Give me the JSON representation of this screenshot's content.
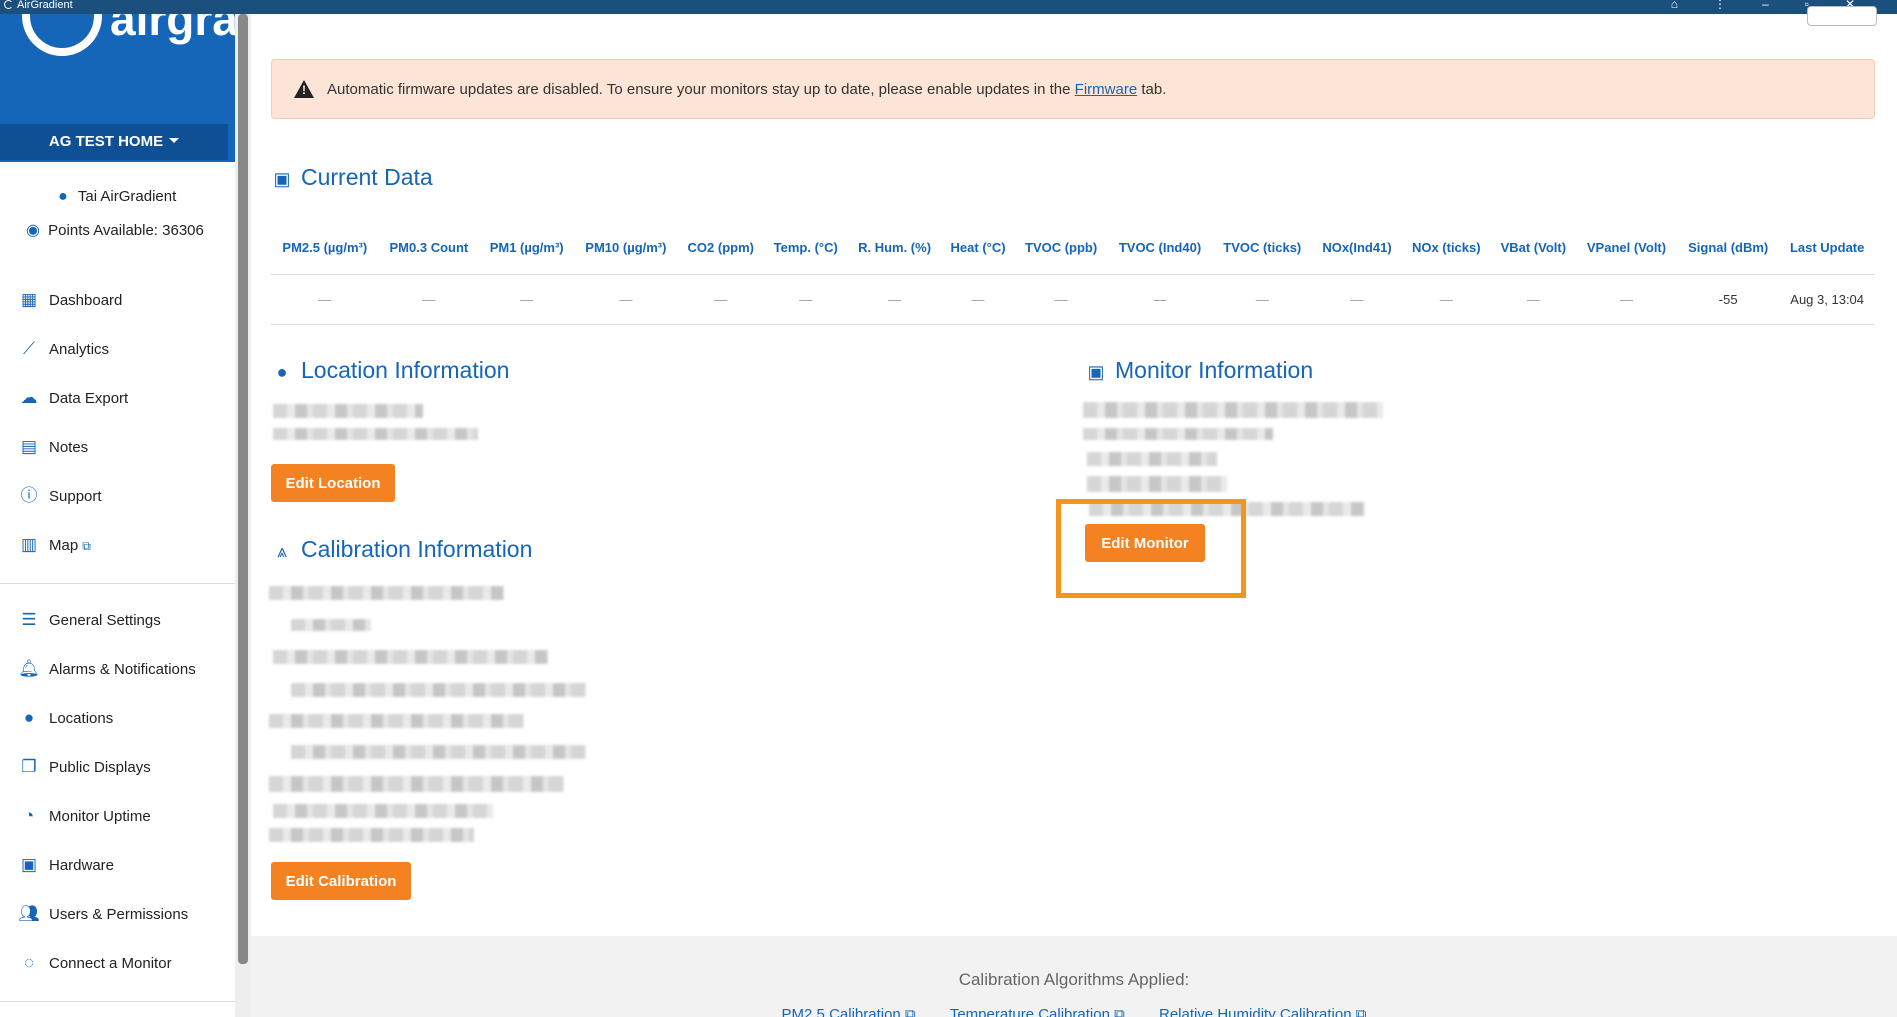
{
  "window": {
    "title": "AirGradient"
  },
  "sidebar": {
    "home": "AG TEST HOME",
    "user": "Tai AirGradient",
    "points": "Points Available: 36306",
    "nav": [
      {
        "label": "Dashboard",
        "icon": "dashboard-icon"
      },
      {
        "label": "Analytics",
        "icon": "analytics-icon"
      },
      {
        "label": "Data Export",
        "icon": "cloud-download-icon"
      },
      {
        "label": "Notes",
        "icon": "notes-icon"
      },
      {
        "label": "Support",
        "icon": "info-icon"
      },
      {
        "label": "Map",
        "icon": "map-icon"
      }
    ],
    "settings": [
      {
        "label": "General Settings",
        "icon": "sliders-icon"
      },
      {
        "label": "Alarms & Notifications",
        "icon": "bell-icon"
      },
      {
        "label": "Locations",
        "icon": "pin-icon"
      },
      {
        "label": "Public Displays",
        "icon": "displays-icon"
      },
      {
        "label": "Monitor Uptime",
        "icon": "uptime-icon"
      },
      {
        "label": "Hardware",
        "icon": "chip-icon"
      },
      {
        "label": "Users & Permissions",
        "icon": "users-icon"
      },
      {
        "label": "Connect a Monitor",
        "icon": "connect-icon"
      }
    ]
  },
  "alert": {
    "text": "Automatic firmware updates are disabled. To ensure your monitors stay up to date, please enable updates in the",
    "link": "Firmware",
    "suffix": "tab."
  },
  "current_data": {
    "title": "Current Data",
    "columns": [
      "PM2.5 (µg/m³)",
      "PM0.3 Count",
      "PM1 (µg/m³)",
      "PM10 (µg/m³)",
      "CO2 (ppm)",
      "Temp. (°C)",
      "R. Hum. (%)",
      "Heat (°C)",
      "TVOC (ppb)",
      "TVOC (Ind40)",
      "TVOC (ticks)",
      "NOx(Ind41)",
      "NOx (ticks)",
      "VBat (Volt)",
      "VPanel (Volt)",
      "Signal (dBm)",
      "Last Update"
    ],
    "row": [
      "—",
      "—",
      "—",
      "—",
      "—",
      "—",
      "—",
      "—",
      "—",
      "—",
      "—",
      "—",
      "—",
      "—",
      "—",
      "-55",
      "Aug 3, 13:04"
    ]
  },
  "location": {
    "title": "Location Information",
    "button": "Edit Location"
  },
  "monitor": {
    "title": "Monitor Information",
    "button": "Edit Monitor"
  },
  "calibration": {
    "title": "Calibration Information",
    "button": "Edit Calibration"
  },
  "footer": {
    "title": "Calibration Algorithms Applied:",
    "links": [
      "PM2.5 Calibration",
      "Temperature Calibration",
      "Relative Humidity Calibration"
    ]
  },
  "colors": {
    "brand": "#1565b8",
    "accent": "#f58220",
    "highlight": "#f7941d"
  }
}
